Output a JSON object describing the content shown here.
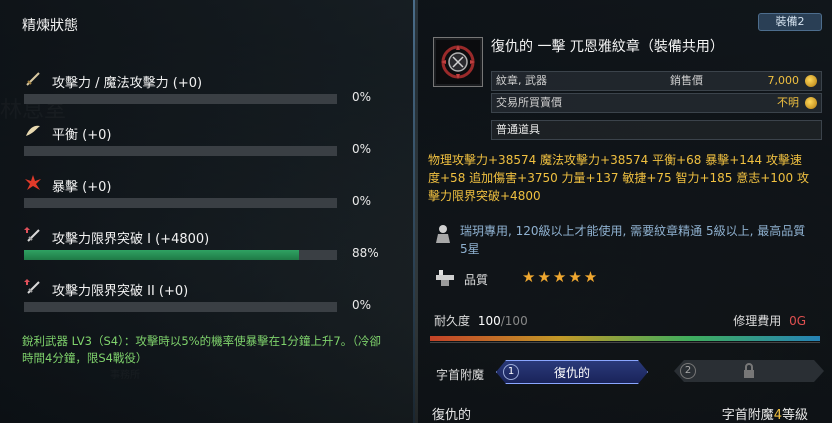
{
  "left": {
    "title": "精煉狀態",
    "stats": [
      {
        "label": "攻擊力 / 魔法攻擊力 (+0)",
        "percent_text": "0%",
        "fill": 0,
        "icon": "sword-icon"
      },
      {
        "label": "平衡 (+0)",
        "percent_text": "0%",
        "fill": 0,
        "icon": "wing-icon"
      },
      {
        "label": "暴擊 (+0)",
        "percent_text": "0%",
        "fill": 0,
        "icon": "burst-icon"
      },
      {
        "label": "攻擊力限界突破 I (+4800)",
        "percent_text": "88%",
        "fill": 0.88,
        "icon": "sword-up-icon"
      },
      {
        "label": "攻擊力限界突破 II (+0)",
        "percent_text": "0%",
        "fill": 0,
        "icon": "sword-up-icon"
      }
    ],
    "description": "銳利武器 LV3（S4）：攻擊時以5%的機率使暴擊在1分鐘上升7。（冷卻時間4分鐘，限S4戰役）"
  },
  "right": {
    "equip_tag": "裝備2",
    "item_name": "復仇的 一擊 兀恩雅紋章（裝備共用）",
    "info_rows": [
      {
        "key": "紋章, 武器",
        "mid": "銷售價",
        "value": "7,000"
      },
      {
        "key": "交易所買賣價",
        "mid": "",
        "value": "不明"
      }
    ],
    "grade": "普通道具",
    "stats_text": "物理攻擊力+38574 魔法攻擊力+38574 平衡+68 暴擊+144 攻擊速度+58 追加傷害+3750 力量+137 敏捷+75 智力+185 意志+100 攻擊力限界突破+4800",
    "class_text": "瑞玥專用, 120級以上才能使用, 需要紋章精通 5級以上, 最高品質5星",
    "quality_label": "品質",
    "quality_stars": "★★★★★",
    "durability_label": "耐久度",
    "durability_current": "100",
    "durability_max": "/100",
    "repair_label": "修理費用",
    "repair_value": "0G",
    "enchant_label": "字首附魔",
    "slots": [
      {
        "num": "1",
        "name": "復仇的"
      },
      {
        "num": "2",
        "name": ""
      }
    ],
    "footer_left": "復仇的",
    "footer_right_prefix": "字首附魔",
    "footer_right_num": "4",
    "footer_right_suffix": "等級"
  },
  "colors": {
    "accent_gold": "#f0c040",
    "green": "#2fa262",
    "blue_text": "#8fb1d0"
  }
}
